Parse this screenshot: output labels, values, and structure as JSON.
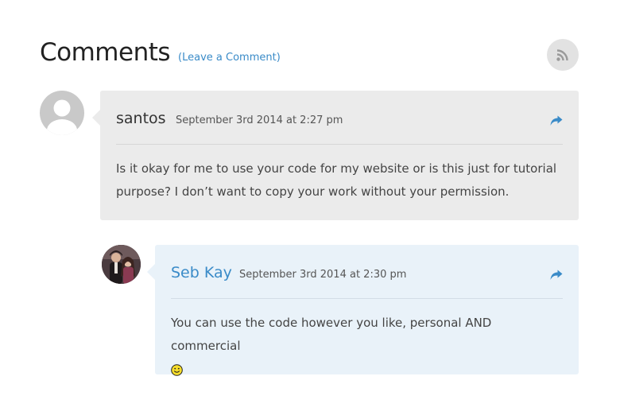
{
  "header": {
    "title": "Comments",
    "leave_comment_label": "(Leave a Comment)"
  },
  "icons": {
    "rss": "rss-icon",
    "reply": "reply-arrow-icon",
    "smiley": "smiley-emoji-icon",
    "default_avatar": "default-user-avatar",
    "photo_avatar": "user-photo-avatar"
  },
  "colors": {
    "link": "#3a8bc8",
    "comment_bg": "#ebebeb",
    "reply_bg": "#e9f2f9"
  },
  "comments": [
    {
      "author": "santos",
      "date": "September 3rd 2014 at 2:27 pm",
      "text": "Is it okay for me to use your code for my website or is this just for tutorial purpose? I don’t want to copy your work without your permission."
    },
    {
      "author": "Seb Kay",
      "date": "September 3rd 2014 at 2:30 pm",
      "text": "You can use the code however you like, personal AND commercial"
    }
  ]
}
